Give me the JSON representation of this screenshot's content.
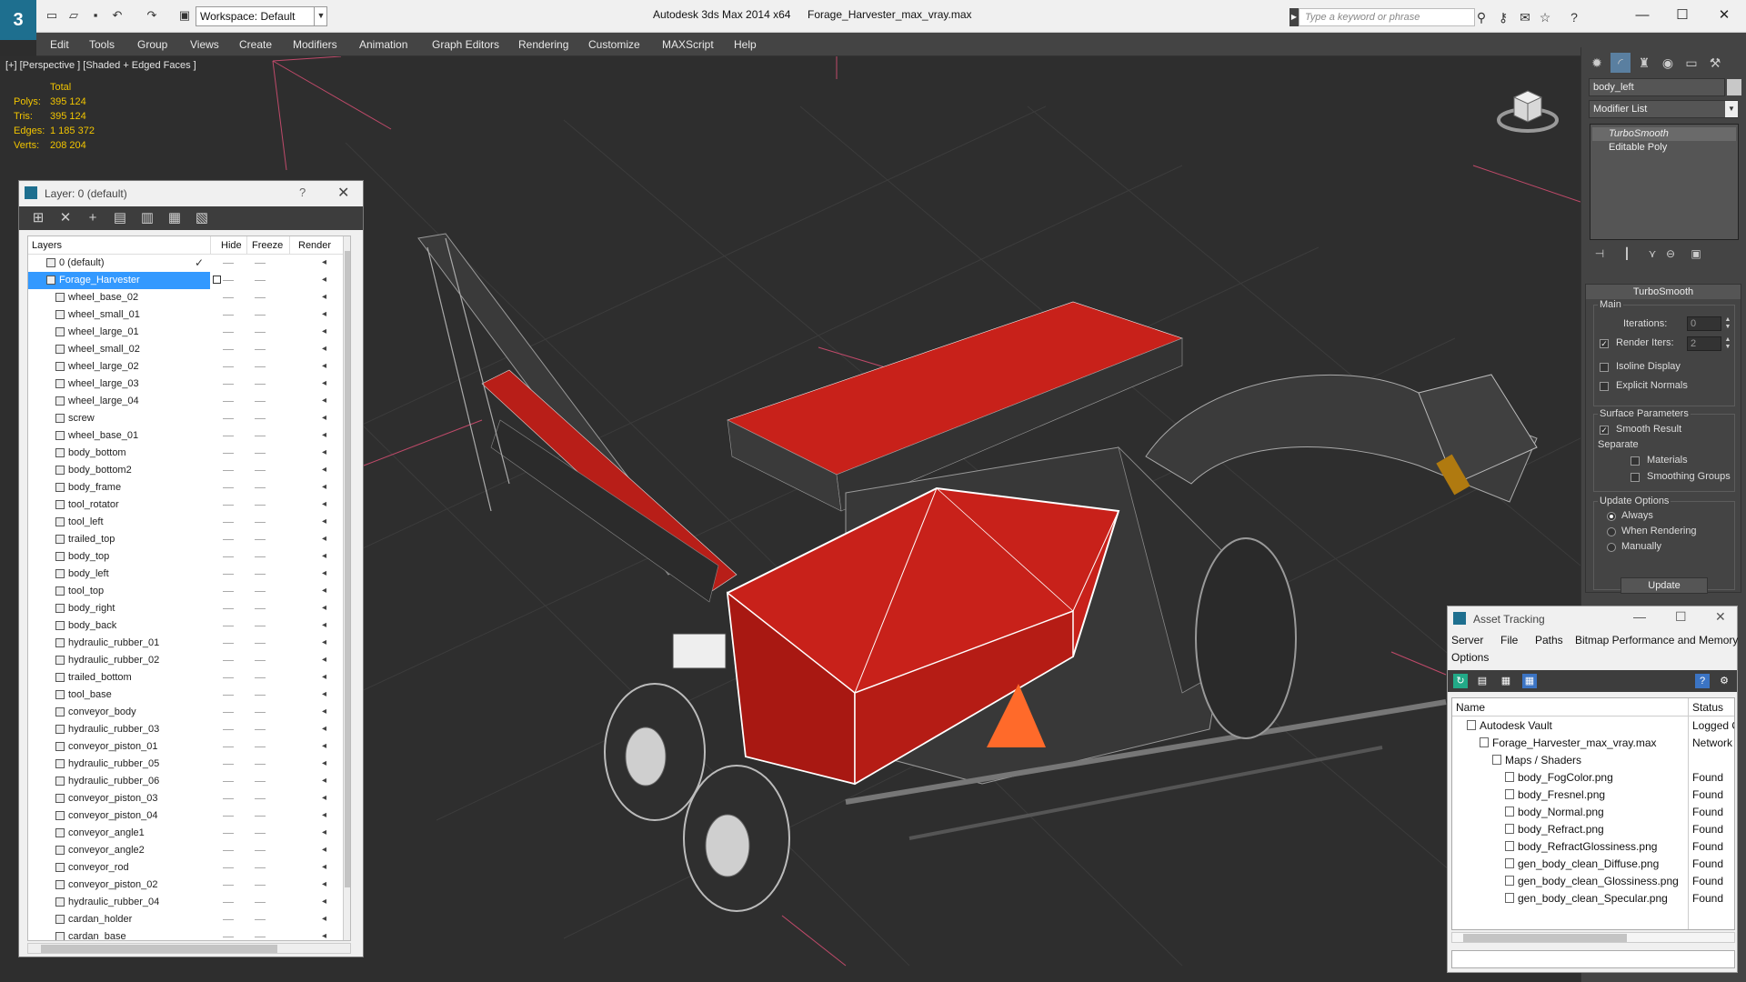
{
  "titlebar": {
    "workspace": "Workspace: Default",
    "app_title": "Autodesk 3ds Max  2014 x64",
    "file_title": "Forage_Harvester_max_vray.max",
    "search_placeholder": "Type a keyword or phrase"
  },
  "menu": [
    "Edit",
    "Tools",
    "Group",
    "Views",
    "Create",
    "Modifiers",
    "Animation",
    "Graph Editors",
    "Rendering",
    "Customize",
    "MAXScript",
    "Help"
  ],
  "viewport": {
    "label": "[+] [Perspective ] [Shaded + Edged Faces ]",
    "stats": {
      "total_label": "Total",
      "rows": [
        {
          "k": "Polys:",
          "v": "395 124"
        },
        {
          "k": "Tris:",
          "v": "395 124"
        },
        {
          "k": "Edges:",
          "v": "1 185 372"
        },
        {
          "k": "Verts:",
          "v": "208 204"
        }
      ]
    }
  },
  "layer_panel": {
    "title": "Layer: 0 (default)",
    "help": "?",
    "columns": {
      "layers": "Layers",
      "hide": "Hide",
      "freeze": "Freeze",
      "render": "Render"
    },
    "layers": [
      {
        "name": "0 (default)",
        "level": 0,
        "checked": true
      },
      {
        "name": "Forage_Harvester",
        "level": 0,
        "selected": true
      },
      {
        "name": "wheel_base_02",
        "level": 1
      },
      {
        "name": "wheel_small_01",
        "level": 1
      },
      {
        "name": "wheel_large_01",
        "level": 1
      },
      {
        "name": "wheel_small_02",
        "level": 1
      },
      {
        "name": "wheel_large_02",
        "level": 1
      },
      {
        "name": "wheel_large_03",
        "level": 1
      },
      {
        "name": "wheel_large_04",
        "level": 1
      },
      {
        "name": "screw",
        "level": 1
      },
      {
        "name": "wheel_base_01",
        "level": 1
      },
      {
        "name": "body_bottom",
        "level": 1
      },
      {
        "name": "body_bottom2",
        "level": 1
      },
      {
        "name": "body_frame",
        "level": 1
      },
      {
        "name": "tool_rotator",
        "level": 1
      },
      {
        "name": "tool_left",
        "level": 1
      },
      {
        "name": "trailed_top",
        "level": 1
      },
      {
        "name": "body_top",
        "level": 1
      },
      {
        "name": "body_left",
        "level": 1
      },
      {
        "name": "tool_top",
        "level": 1
      },
      {
        "name": "body_right",
        "level": 1
      },
      {
        "name": "body_back",
        "level": 1
      },
      {
        "name": "hydraulic_rubber_01",
        "level": 1
      },
      {
        "name": "hydraulic_rubber_02",
        "level": 1
      },
      {
        "name": "trailed_bottom",
        "level": 1
      },
      {
        "name": "tool_base",
        "level": 1
      },
      {
        "name": "conveyor_body",
        "level": 1
      },
      {
        "name": "hydraulic_rubber_03",
        "level": 1
      },
      {
        "name": "conveyor_piston_01",
        "level": 1
      },
      {
        "name": "hydraulic_rubber_05",
        "level": 1
      },
      {
        "name": "hydraulic_rubber_06",
        "level": 1
      },
      {
        "name": "conveyor_piston_03",
        "level": 1
      },
      {
        "name": "conveyor_piston_04",
        "level": 1
      },
      {
        "name": "conveyor_angle1",
        "level": 1
      },
      {
        "name": "conveyor_angle2",
        "level": 1
      },
      {
        "name": "conveyor_rod",
        "level": 1
      },
      {
        "name": "conveyor_piston_02",
        "level": 1
      },
      {
        "name": "hydraulic_rubber_04",
        "level": 1
      },
      {
        "name": "cardan_holder",
        "level": 1
      },
      {
        "name": "cardan_base",
        "level": 1
      }
    ]
  },
  "command_panel": {
    "object_name": "body_left",
    "modifier_list": "Modifier List",
    "stack": [
      "TurboSmooth",
      "Editable Poly"
    ],
    "rollout_title": "TurboSmooth",
    "main_label": "Main",
    "iterations_label": "Iterations:",
    "iterations_value": "0",
    "render_iters_label": "Render Iters:",
    "render_iters_value": "2",
    "render_iters_checked": true,
    "isoline_label": "Isoline Display",
    "explicit_label": "Explicit Normals",
    "surface_label": "Surface Parameters",
    "smooth_label": "Smooth Result",
    "separate_label": "Separate",
    "materials_label": "Materials",
    "smoothing_groups_label": "Smoothing Groups",
    "update_options_label": "Update Options",
    "always_label": "Always",
    "when_rendering_label": "When Rendering",
    "manually_label": "Manually",
    "update_button": "Update"
  },
  "asset_tracking": {
    "title": "Asset Tracking",
    "menu": [
      "Server",
      "File",
      "Paths",
      "Bitmap Performance and Memory",
      "Options"
    ],
    "columns": {
      "name": "Name",
      "status": "Status"
    },
    "rows": [
      {
        "name": "Autodesk Vault",
        "status": "Logged O",
        "level": 0
      },
      {
        "name": "Forage_Harvester_max_vray.max",
        "status": "Network",
        "level": 1
      },
      {
        "name": "Maps / Shaders",
        "status": "",
        "level": 2
      },
      {
        "name": "body_FogColor.png",
        "status": "Found",
        "level": 3
      },
      {
        "name": "body_Fresnel.png",
        "status": "Found",
        "level": 3
      },
      {
        "name": "body_Normal.png",
        "status": "Found",
        "level": 3
      },
      {
        "name": "body_Refract.png",
        "status": "Found",
        "level": 3
      },
      {
        "name": "body_RefractGlossiness.png",
        "status": "Found",
        "level": 3
      },
      {
        "name": "gen_body_clean_Diffuse.png",
        "status": "Found",
        "level": 3
      },
      {
        "name": "gen_body_clean_Glossiness.png",
        "status": "Found",
        "level": 3
      },
      {
        "name": "gen_body_clean_Specular.png",
        "status": "Found",
        "level": 3
      }
    ]
  },
  "colors": {
    "accent": "#1e6f8f",
    "stats_yellow": "#f1c400",
    "model_red": "#c8211a",
    "selection_blue": "#3399ff"
  }
}
